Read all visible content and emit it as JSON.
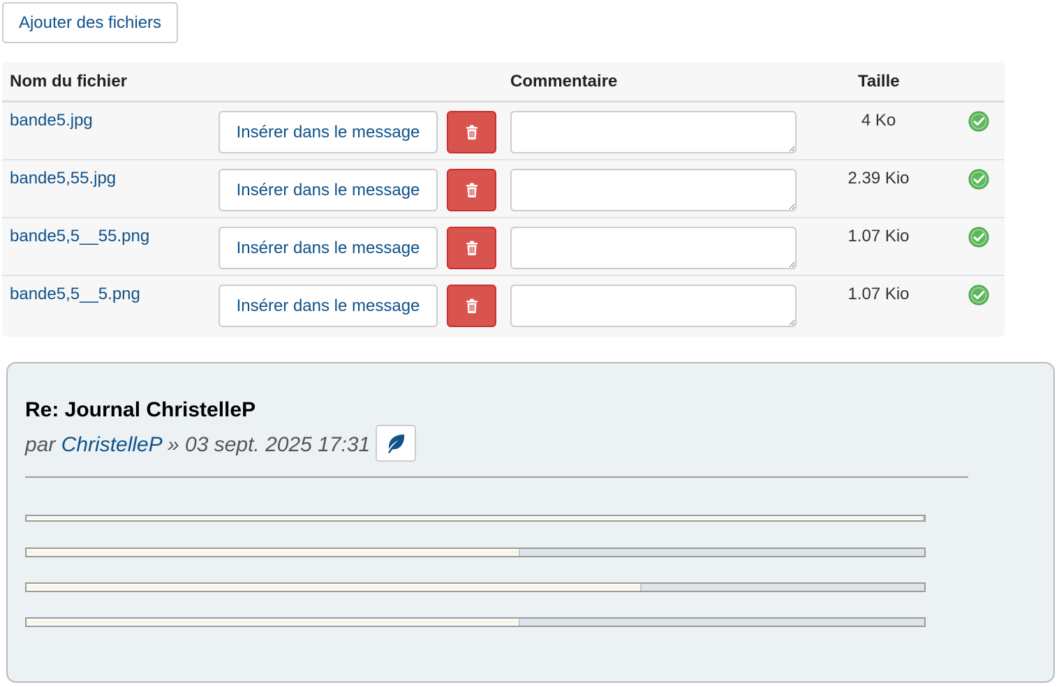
{
  "add_files_button": "Ajouter des fichiers",
  "table": {
    "headers": {
      "filename": "Nom du fichier",
      "comment": "Commentaire",
      "size": "Taille"
    },
    "rows": [
      {
        "filename": "bande5.jpg",
        "insert_label": "Insérer dans le message",
        "comment": "",
        "size": "4 Ko",
        "status_icon": "check-circle-icon"
      },
      {
        "filename": "bande5,55.jpg",
        "insert_label": "Insérer dans le message",
        "comment": "",
        "size": "2.39 Kio",
        "status_icon": "check-circle-icon"
      },
      {
        "filename": "bande5,5__55.png",
        "insert_label": "Insérer dans le message",
        "comment": "",
        "size": "1.07 Kio",
        "status_icon": "check-circle-icon"
      },
      {
        "filename": "bande5,5__5.png",
        "insert_label": "Insérer dans le message",
        "comment": "",
        "size": "1.07 Kio",
        "status_icon": "check-circle-icon"
      }
    ]
  },
  "post": {
    "title": "Re: Journal ChristelleP",
    "by": "par",
    "author": "ChristelleP",
    "separator": "»",
    "datetime": "03 sept. 2025 17:31",
    "leaf_icon": "leaf-icon",
    "progress_bars": [
      {
        "fill_fraction": 1.0
      },
      {
        "fill_fraction": 0.55
      },
      {
        "fill_fraction": 0.685
      },
      {
        "fill_fraction": 0.55
      }
    ]
  },
  "colors": {
    "link": "#105289",
    "danger": "#d9534f",
    "success": "#5cb85c",
    "post_background": "#ecf1f4"
  }
}
